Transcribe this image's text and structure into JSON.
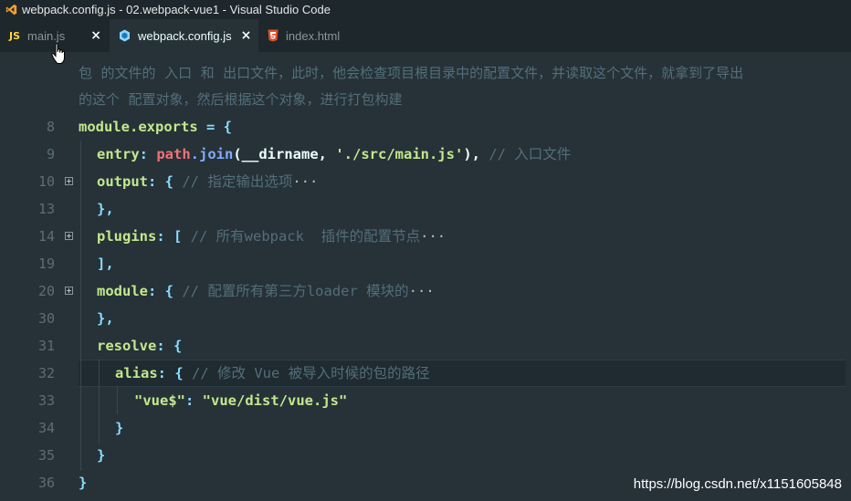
{
  "window": {
    "title": "webpack.config.js - 02.webpack-vue1 - Visual Studio Code"
  },
  "tabs": [
    {
      "badge": "JS",
      "label": "main.js",
      "close": "×"
    },
    {
      "label": "webpack.config.js",
      "close": "×"
    },
    {
      "label": "index.html"
    }
  ],
  "comment_lines": [
    "包  的文件的  入口  和  出口文件，此时，他会检查项目根目录中的配置文件，并读取这个文件，就拿到了导出",
    "的这个  配置对象，然后根据这个对象，进行打包构建"
  ],
  "code": {
    "l8": {
      "num": "8",
      "a": "module.exports",
      "b": " = {"
    },
    "l9": {
      "num": "9",
      "a": "entry",
      "b": ": ",
      "c": "path",
      "d": ".join",
      "e": "(__dirname, ",
      "f": "'./src/main.js'",
      "g": "), ",
      "h": "// 入口文件"
    },
    "l10": {
      "num": "10",
      "a": "output",
      "b": ": { ",
      "h": "// 指定输出选项",
      "ell": "···"
    },
    "l13": {
      "num": "13",
      "a": "},",
      "b": ""
    },
    "l14": {
      "num": "14",
      "a": "plugins",
      "b": ": [ ",
      "h": "// 所有webpack  插件的配置节点",
      "ell": "···"
    },
    "l19": {
      "num": "19",
      "a": "],",
      "b": ""
    },
    "l20": {
      "num": "20",
      "a": "module",
      "b": ": { ",
      "h": "// 配置所有第三方loader 模块的",
      "ell": "···"
    },
    "l30": {
      "num": "30",
      "a": "},",
      "b": ""
    },
    "l31": {
      "num": "31",
      "a": "resolve",
      "b": ": {"
    },
    "l32": {
      "num": "32",
      "a": "alias",
      "b": ": { ",
      "h": "// 修改 Vue 被导入时候的包的路径"
    },
    "l33": {
      "num": "33",
      "a": "\"vue$\"",
      "b": ": ",
      "c": "\"vue/dist/vue.js\""
    },
    "l34": {
      "num": "34",
      "a": "}"
    },
    "l35": {
      "num": "35",
      "a": "}"
    },
    "l36": {
      "num": "36",
      "a": "}"
    }
  },
  "watermark": "https://blog.csdn.net/x1151605848",
  "colors": {
    "background": "#263238",
    "tabbar": "#1e272c",
    "string": "#c3e88d",
    "comment": "#546e7a"
  }
}
